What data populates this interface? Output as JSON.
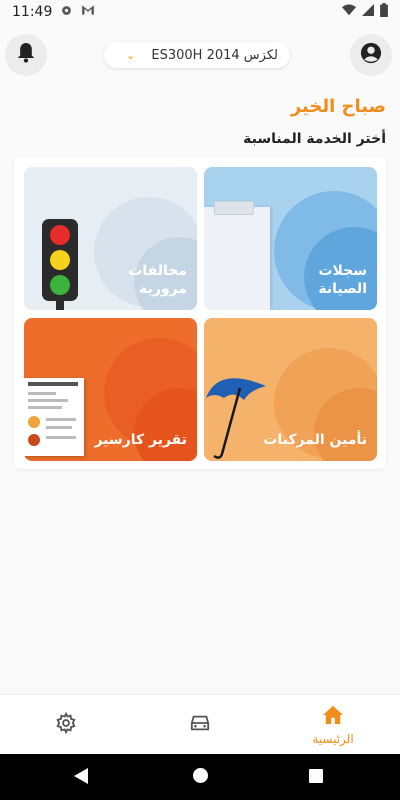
{
  "status": {
    "time": "11:49",
    "icons": [
      "gear-icon",
      "gmail-icon",
      "wifi-icon",
      "signal-icon",
      "battery-icon"
    ]
  },
  "header": {
    "bell_icon": "bell-icon",
    "profile_icon": "account-circle-icon",
    "car_selector": "لكزس ES300H 2014",
    "chevron_icon": "chevron-down-icon"
  },
  "greeting": "صباح الخير",
  "subtitle": "أختر الخدمة المناسبة",
  "services": {
    "maintenance": "سجلات الصيانة",
    "traffic": "مخالفات مرورية",
    "insurance": "تأمين المركبات",
    "report": "تقرير كارسير"
  },
  "nav": {
    "home_label": "الرئيسية",
    "home_icon": "home-icon",
    "car_icon": "car-icon",
    "settings_icon": "settings-icon"
  },
  "colors": {
    "accent": "#f28c1c",
    "maintenance_tile": "#a9d2ef",
    "traffic_tile": "#e6edf3",
    "insurance_tile": "#f4b26a",
    "report_tile": "#ee6d2a"
  }
}
